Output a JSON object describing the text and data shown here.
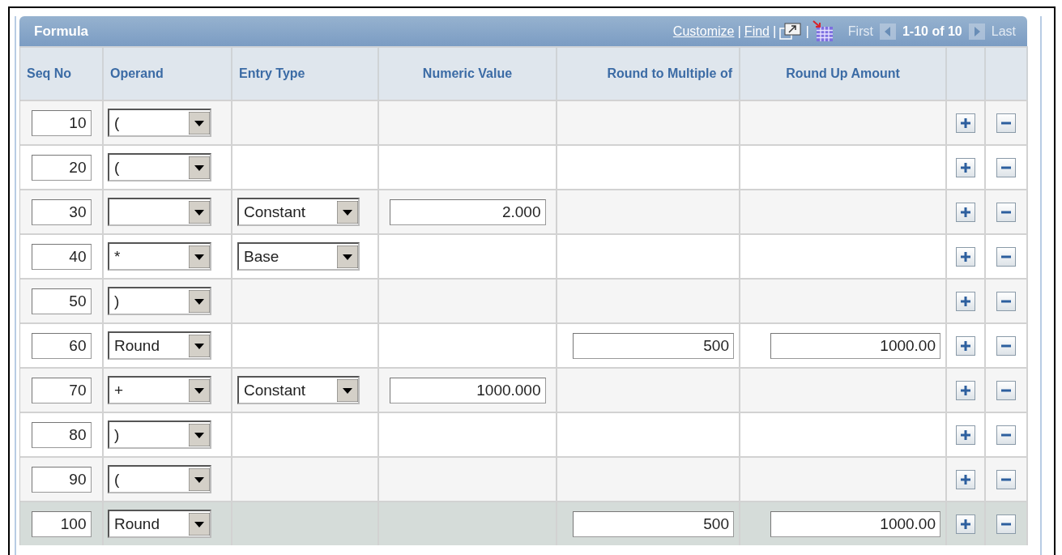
{
  "grid": {
    "title": "Formula",
    "links": [
      "Customize",
      "Find"
    ],
    "separators": [
      "|",
      "|",
      "|"
    ],
    "navigation": {
      "first": {
        "label": "First",
        "disabled": true
      },
      "range": "1-10 of 10",
      "last": {
        "label": "Last",
        "disabled": true
      }
    }
  },
  "columns": [
    "Seq No",
    "Operand",
    "Entry Type",
    "Numeric Value",
    "Round to Multiple of",
    "Round Up Amount"
  ],
  "rows": [
    {
      "seq": "10",
      "operand": "(",
      "selected": false
    },
    {
      "seq": "20",
      "operand": "(",
      "selected": false
    },
    {
      "seq": "30",
      "entry_type": "Constant",
      "numeric_value": "2.000",
      "selected": false
    },
    {
      "seq": "40",
      "operand": "*",
      "entry_type": "Base",
      "selected": false
    },
    {
      "seq": "50",
      "operand": ")",
      "selected": false
    },
    {
      "seq": "60",
      "operand": "Round",
      "round_multiple": "500",
      "round_up": "1000.00",
      "selected": false
    },
    {
      "seq": "70",
      "operand": "+",
      "entry_type": "Constant",
      "numeric_value": "1000.000",
      "selected": false
    },
    {
      "seq": "80",
      "operand": ")",
      "selected": false
    },
    {
      "seq": "90",
      "operand": "(",
      "selected": false
    },
    {
      "seq": "100",
      "operand": "Round",
      "round_multiple": "500",
      "round_up": "1000.00",
      "selected": true
    }
  ]
}
